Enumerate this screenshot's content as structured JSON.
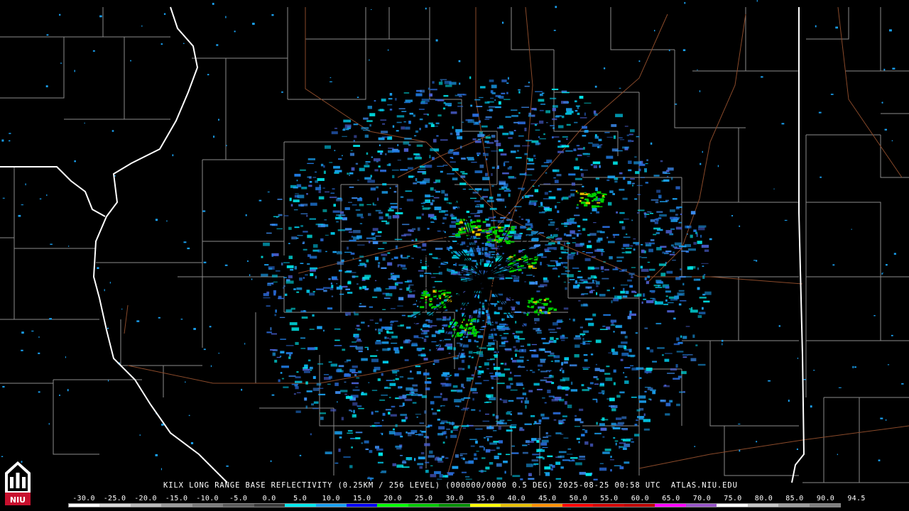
{
  "product_caption": "KILX LONG RANGE BASE REFLECTIVITY (0.25KM / 256 LEVEL) (000000/0000 0.5 DEG) 2025-08-25 00:58 UTC  ATLAS.NIU.EDU",
  "logo_text": "NIU",
  "colors": {
    "background": "#000000",
    "county_lines": "#8c8c8c",
    "state_lines": "#ffffff",
    "roads": "#8a4a2a"
  },
  "scale": {
    "labels": [
      "-30.0",
      "-25.0",
      "-20.0",
      "-15.0",
      "-10.0",
      "-5.0",
      "0.0",
      "5.0",
      "10.0",
      "15.0",
      "20.0",
      "25.0",
      "30.0",
      "35.0",
      "40.0",
      "45.0",
      "50.0",
      "55.0",
      "60.0",
      "65.0",
      "70.0",
      "75.0",
      "80.0",
      "85.0",
      "90.0",
      "94.5"
    ],
    "colors": [
      "#ffffff",
      "#dcdcdc",
      "#bcbcbc",
      "#9c9c9c",
      "#7c7c7c",
      "#5c5c5c",
      "#3c3c3c",
      "#00e8ec",
      "#1aa0f0",
      "#0000f6",
      "#00ff00",
      "#00c800",
      "#009000",
      "#ffff00",
      "#e7c000",
      "#ff9000",
      "#ff0000",
      "#d60000",
      "#c00000",
      "#ff00ff",
      "#9955c9",
      "#ffffff",
      "#c8c8c8",
      "#a0a0a0",
      "#808080"
    ]
  }
}
